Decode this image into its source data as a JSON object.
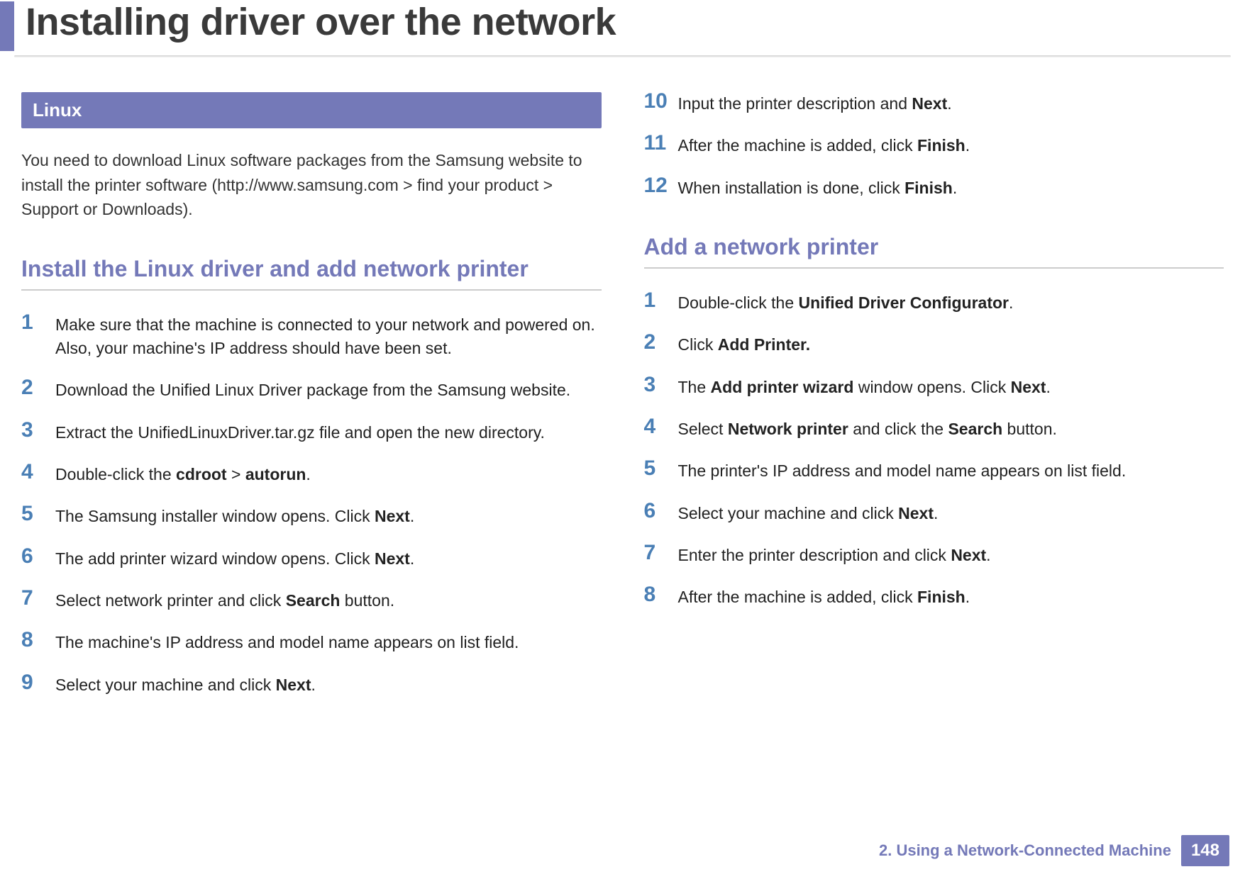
{
  "title": "Installing driver over the network",
  "section_band": "Linux",
  "intro": "You need to download Linux software packages from the Samsung website to install the printer software (http://www.samsung.com > find your product > Support or Downloads).",
  "sub1": "Install the Linux driver and add network printer",
  "left_steps": {
    "s1": "Make sure that the machine is connected to your network and powered on. Also, your machine's IP address should have been set.",
    "s2": "Download the Unified Linux Driver package from the Samsung website.",
    "s3": "Extract the UnifiedLinuxDriver.tar.gz file and open the new directory.",
    "s4_a": "Double-click the ",
    "s4_b": "cdroot",
    "s4_c": " > ",
    "s4_d": "autorun",
    "s4_e": ".",
    "s5_a": "The Samsung installer window opens. Click ",
    "s5_b": "Next",
    "s5_c": ".",
    "s6_a": "The add printer wizard window opens. Click ",
    "s6_b": "Next",
    "s6_c": ".",
    "s7_a": "Select network printer and click ",
    "s7_b": "Search",
    "s7_c": " button.",
    "s8": "The machine's IP address and model name appears on list field.",
    "s9_a": "Select your machine and click ",
    "s9_b": "Next",
    "s9_c": "."
  },
  "right_top": {
    "s10_a": "Input the printer description and ",
    "s10_b": "Next",
    "s10_c": ".",
    "s11_a": "After the machine is added, click ",
    "s11_b": "Finish",
    "s11_c": ".",
    "s12_a": "When installation is done, click ",
    "s12_b": "Finish",
    "s12_c": "."
  },
  "sub2": "Add a network printer",
  "right_steps": {
    "s1_a": "Double-click the ",
    "s1_b": "Unified Driver Configurator",
    "s1_c": ".",
    "s2_a": "Click ",
    "s2_b": "Add Printer.",
    "s3_a": "The ",
    "s3_b": "Add printer wizard",
    "s3_c": " window opens. Click ",
    "s3_d": "Next",
    "s3_e": ".",
    "s4_a": "Select ",
    "s4_b": "Network printer",
    "s4_c": " and click the ",
    "s4_d": "Search",
    "s4_e": " button.",
    "s5": "The printer's IP address and model name appears on list field.",
    "s6_a": "Select your machine and click ",
    "s6_b": "Next",
    "s6_c": ".",
    "s7_a": "Enter the printer description and click ",
    "s7_b": "Next",
    "s7_c": ".",
    "s8_a": "After the machine is added, click ",
    "s8_b": "Finish",
    "s8_c": "."
  },
  "footer_chapter": "2.  Using a Network-Connected Machine",
  "page_number": "148",
  "nums": {
    "n1": "1",
    "n2": "2",
    "n3": "3",
    "n4": "4",
    "n5": "5",
    "n6": "6",
    "n7": "7",
    "n8": "8",
    "n9": "9",
    "n10": "10",
    "n11": "11",
    "n12": "12"
  }
}
